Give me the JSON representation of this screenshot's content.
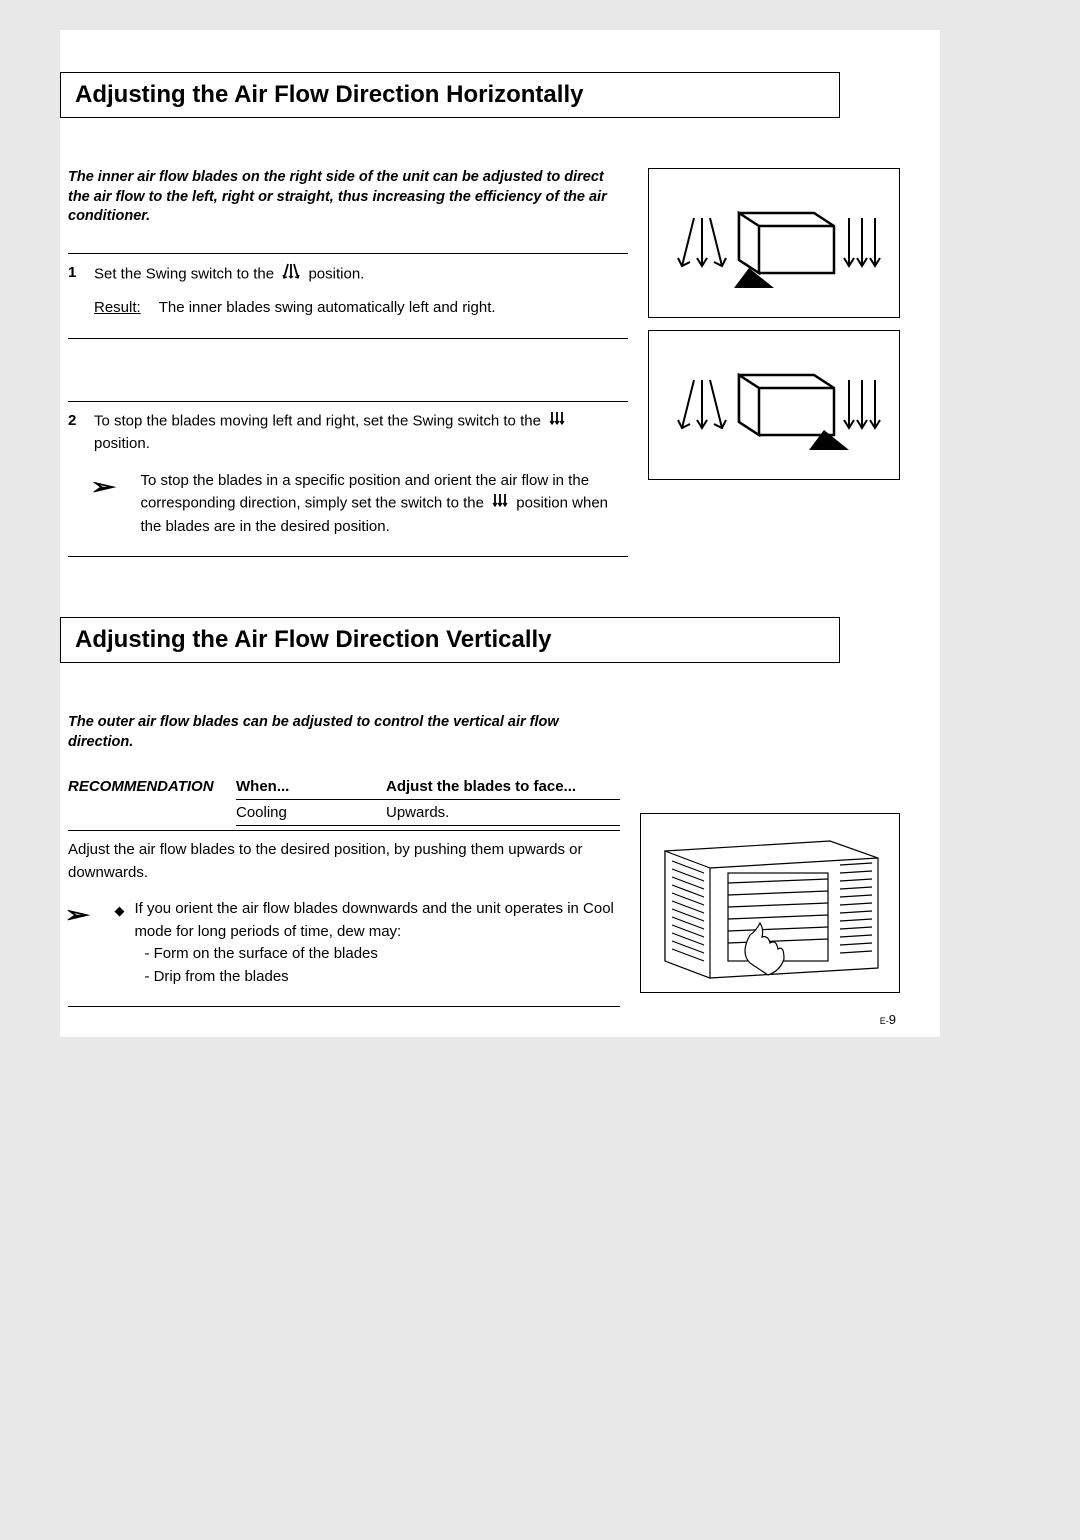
{
  "section1": {
    "title": "Adjusting the Air Flow Direction Horizontally",
    "intro": "The inner air flow blades on the right side of the unit can be adjusted to direct the air flow to the left, right or straight, thus increasing the efficiency of the air conditioner.",
    "step1": {
      "num": "1",
      "text_a": "Set the Swing switch to the",
      "text_b": "position.",
      "result_label": "Result:",
      "result_text": "The inner blades swing automatically left and right."
    },
    "step2": {
      "num": "2",
      "text_a": "To stop the blades moving left and right, set the Swing switch to the",
      "text_b": "position.",
      "note_a": "To stop the blades in a specific position and orient the air flow in the corresponding direction, simply set the switch to the",
      "note_b": "position when the blades are in the desired position."
    }
  },
  "section2": {
    "title": "Adjusting the Air Flow Direction Vertically",
    "intro": "The outer air flow blades can be adjusted to control the vertical air flow direction.",
    "rec_label": "RECOMMENDATION",
    "table": {
      "h1": "When...",
      "h2": "Adjust the blades to face...",
      "r1c1": "Cooling",
      "r1c2": "Upwards."
    },
    "adjust_text": "Adjust the air flow blades to the desired position, by pushing them upwards or downwards.",
    "note_main": "If you orient the air flow blades downwards and the unit operates in Cool mode for long periods of time, dew may:",
    "note_l1": "- Form on the surface of the blades",
    "note_l2": "- Drip from the blades"
  },
  "page_number_prefix": "E-",
  "page_number": "9"
}
